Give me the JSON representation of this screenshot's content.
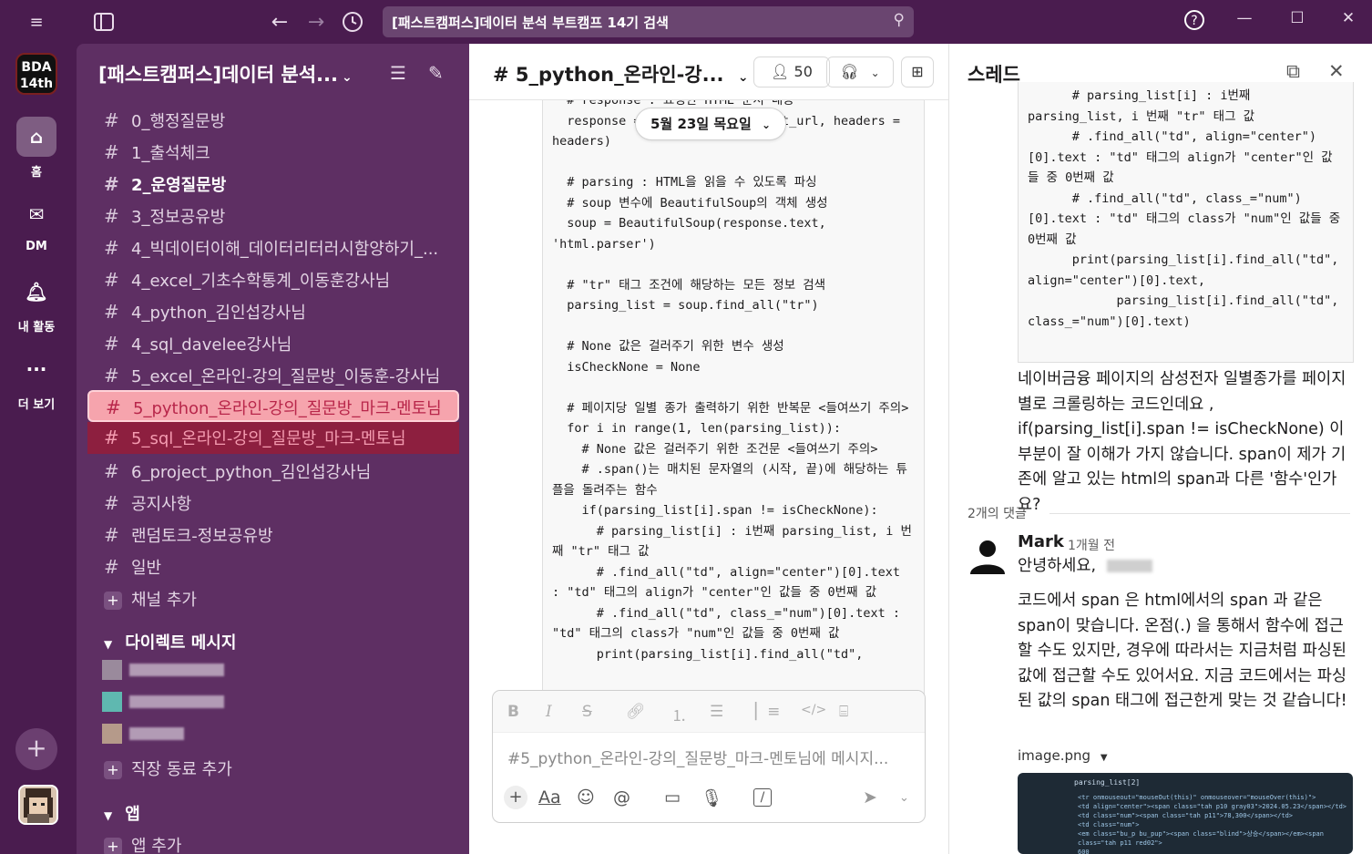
{
  "titlebar": {
    "search_text": "[패스트캠퍼스]데이터 분석 부트캠프 14기 검색"
  },
  "rail": {
    "workspace_logo_line1": "BDA",
    "workspace_logo_line2": "14th",
    "home_label": "홈",
    "dm_label": "DM",
    "activity_label": "내 활동",
    "more_label": "더 보기"
  },
  "sidebar": {
    "workspace_name": "[패스트캠퍼스]데이터 분석...",
    "channels": [
      {
        "name": "0_행정질문방"
      },
      {
        "name": "1_출석체크"
      },
      {
        "name": "2_운영질문방"
      },
      {
        "name": "3_정보공유방"
      },
      {
        "name": "4_빅데이터이해_데이터리터러시함양하기_..."
      },
      {
        "name": "4_excel_기초수학통계_이동훈강사님"
      },
      {
        "name": "4_python_김인섭강사님"
      },
      {
        "name": "4_sql_davelee강사님"
      },
      {
        "name": "5_excel_온라인-강의_질문방_이동훈-강사님"
      },
      {
        "name": "5_python_온라인-강의_질문방_마크-멘토님"
      },
      {
        "name": "5_sql_온라인-강의_질문방_마크-멘토님"
      },
      {
        "name": "6_project_python_김인섭강사님"
      },
      {
        "name": "공지사항"
      },
      {
        "name": "랜덤토크-정보공유방"
      },
      {
        "name": "일반"
      }
    ],
    "add_channel": "채널 추가",
    "dm_section": "다이렉트 메시지",
    "add_coworker": "직장 동료 추가",
    "apps_section": "앱",
    "add_app": "앱 추가"
  },
  "main": {
    "channel_title": "# 5_python_온라인-강...",
    "member_count": "50",
    "date_pill": "5월 23일 목요일",
    "code_lines": "  # response : 요청한 HTML 문서 내용\n  response = requests.get(target_url, headers = headers)\n\n  # parsing : HTML을 읽을 수 있도록 파싱\n  # soup 변수에 BeautifulSoup의 객체 생성\n  soup = BeautifulSoup(response.text, 'html.parser')\n\n  # \"tr\" 태그 조건에 해당하는 모든 정보 검색\n  parsing_list = soup.find_all(\"tr\")\n\n  # None 값은 걸러주기 위한 변수 생성\n  isCheckNone = None\n\n  # 페이지당 일별 종가 출력하기 위한 반복문 <들여쓰기 주의>\n  for i in range(1, len(parsing_list)):\n    # None 값은 걸러주기 위한 조건문 <들여쓰기 주의>\n    # .span()는 매치된 문자열의 (시작, 끝)에 해당하는 튜플을 돌려주는 함수\n    if(parsing_list[i].span != isCheckNone):\n      # parsing_list[i] : i번째 parsing_list, i 번째 \"tr\" 태그 값\n      # .find_all(\"td\", align=\"center\")[0].text : \"td\" 태그의 align가 \"center\"인 값들 중 0번째 값\n      # .find_all(\"td\", class_=\"num\")[0].text : \"td\" 태그의 class가 \"num\"인 값들 중 0번째 값\n      print(parsing_list[i].find_all(\"td\",",
    "composer_placeholder": "#5_python_온라인-강의_질문방_마크-멘토님에 메시지..."
  },
  "thread": {
    "title": "스레드",
    "code_lines": "      # parsing_list[i] : i번째 parsing_list, i 번째 \"tr\" 태그 값\n      # .find_all(\"td\", align=\"center\")[0].text : \"td\" 태그의 align가 \"center\"인 값들 중 0번째 값\n      # .find_all(\"td\", class_=\"num\")[0].text : \"td\" 태그의 class가 \"num\"인 값들 중 0번째 값\n      print(parsing_list[i].find_all(\"td\", align=\"center\")[0].text,\n            parsing_list[i].find_all(\"td\", class_=\"num\")[0].text)",
    "question": "네이버금융 페이지의 삼성전자 일별종가를 페이지별로 크롤링하는 코드인데요 , if(parsing_list[i].span != isCheckNone) 이부분이 잘 이해가 가지 않습니다. span이 제가 기존에 알고 있는 html의 span과 다른 '함수'인가요?",
    "replies_count": "2개의 댓글",
    "reply_author": "Mark",
    "reply_time": "1개월 전",
    "reply_greeting": "안녕하세요,",
    "reply_body": "코드에서 span 은 html에서의 span 과 같은 span이 맞습니다. 온점(.) 을 통해서 함수에 접근할 수도 있지만, 경우에 따라서는 지금처럼 파싱된 값에 접근할 수도 있어서요. 지금 코드에서는 파싱된 값의 span 태그에 접근한게 맞는 것 같습니다!",
    "attachment_name": "image.png",
    "attachment_preview_title": "parsing_list[2]",
    "attachment_preview_text": "<tr onmouseout=\"mouseOut(this)\" onmouseover=\"mouseOver(this)\">\n<td align=\"center\"><span class=\"tah p10 gray03\">2024.05.23</span></td>\n<td class=\"num\"><span class=\"tah p11\">78,300</span></td>\n<td class=\"num\">\n<em class=\"bu_p bu_pup\"><span class=\"blind\">상승</span></em><span class=\"tah p11 red02\">\n600"
  }
}
